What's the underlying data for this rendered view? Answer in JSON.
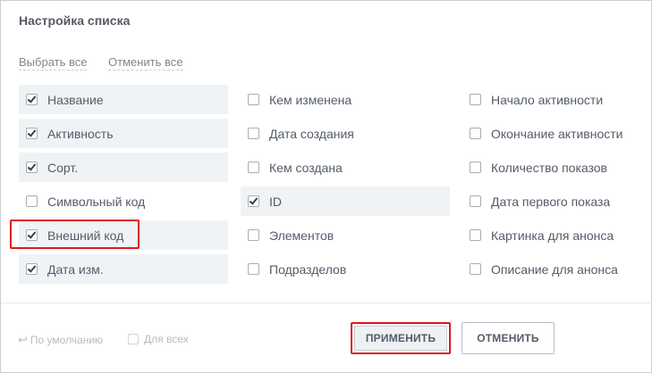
{
  "dialog": {
    "title": "Настройка списка",
    "select_all": "Выбрать все",
    "deselect_all": "Отменить все"
  },
  "columns": [
    [
      {
        "label": "Название",
        "checked": true
      },
      {
        "label": "Активность",
        "checked": true
      },
      {
        "label": "Сорт.",
        "checked": true
      },
      {
        "label": "Символьный код",
        "checked": false
      },
      {
        "label": "Внешний код",
        "checked": true
      },
      {
        "label": "Дата изм.",
        "checked": true
      }
    ],
    [
      {
        "label": "Кем изменена",
        "checked": false
      },
      {
        "label": "Дата создания",
        "checked": false
      },
      {
        "label": "Кем создана",
        "checked": false
      },
      {
        "label": "ID",
        "checked": true
      },
      {
        "label": "Элементов",
        "checked": false
      },
      {
        "label": "Подразделов",
        "checked": false
      }
    ],
    [
      {
        "label": "Начало активности",
        "checked": false
      },
      {
        "label": "Окончание активности",
        "checked": false
      },
      {
        "label": "Количество показов",
        "checked": false
      },
      {
        "label": "Дата первого показа",
        "checked": false
      },
      {
        "label": "Картинка для анонса",
        "checked": false
      },
      {
        "label": "Описание для анонса",
        "checked": false
      }
    ]
  ],
  "footer": {
    "default_label": "По умолчанию",
    "for_all_label": "Для всех",
    "apply_label": "ПРИМЕНИТЬ",
    "cancel_label": "ОТМЕНИТЬ"
  }
}
